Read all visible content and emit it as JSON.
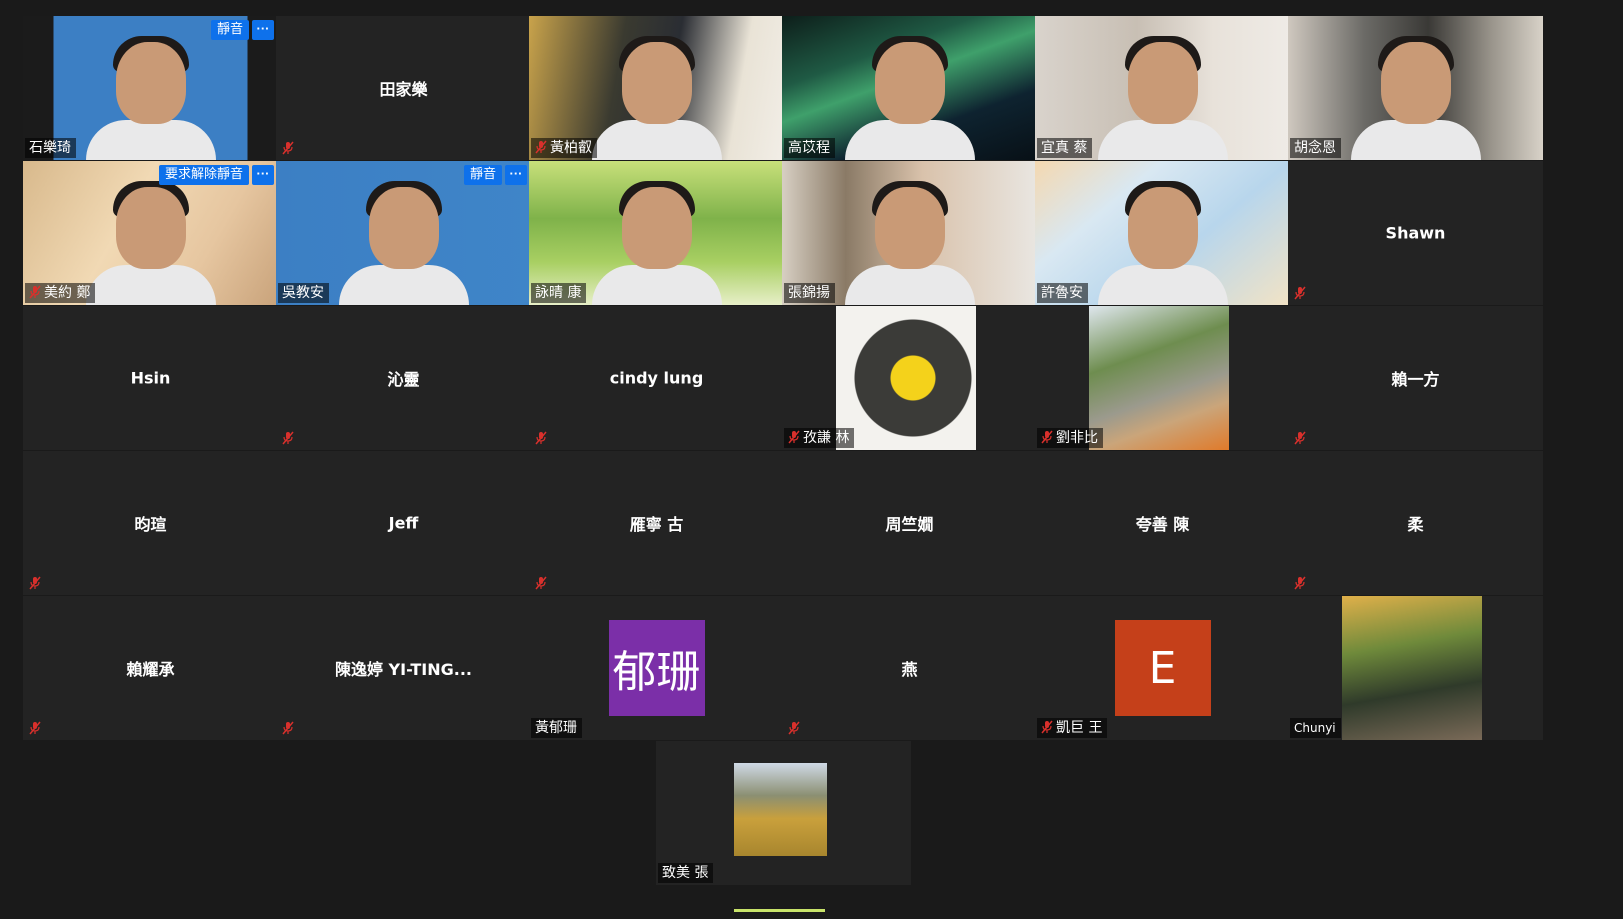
{
  "participants": [
    {
      "name": "石樂琦",
      "mode": "video",
      "speaking": true,
      "badge": "靜音",
      "more": "···",
      "muted": false
    },
    {
      "name": "田家樂",
      "mode": "name",
      "muted": true
    },
    {
      "name": "黃柏叡",
      "mode": "video",
      "muted": true
    },
    {
      "name": "高苡程",
      "mode": "video",
      "muted": false
    },
    {
      "name": "宜真 蔡",
      "mode": "video",
      "muted": false
    },
    {
      "name": "胡念恩",
      "mode": "video",
      "muted": false
    },
    {
      "name": "美約 鄭",
      "mode": "video",
      "badge": "要求解除靜音",
      "more": "···",
      "muted": true
    },
    {
      "name": "吳教安",
      "mode": "video",
      "badge": "靜音",
      "more": "···",
      "muted": false
    },
    {
      "name": "詠晴 康",
      "mode": "video",
      "muted": false
    },
    {
      "name": "張錦揚",
      "mode": "video",
      "muted": false
    },
    {
      "name": "許魯安",
      "mode": "video",
      "muted": false
    },
    {
      "name": "Shawn",
      "mode": "name",
      "muted": true
    },
    {
      "name": "Hsin",
      "mode": "name",
      "muted": false
    },
    {
      "name": "沁靈",
      "mode": "name",
      "muted": true
    },
    {
      "name": "cindy lung",
      "mode": "name",
      "muted": true
    },
    {
      "name": "孜謙 林",
      "mode": "picture",
      "muted": true
    },
    {
      "name": "劉非比",
      "mode": "picture",
      "muted": true
    },
    {
      "name": "賴一方",
      "mode": "name",
      "muted": true
    },
    {
      "name": "昀瑄",
      "mode": "name",
      "muted": true
    },
    {
      "name": "Jeff",
      "mode": "name",
      "muted": false
    },
    {
      "name": "雁寧 古",
      "mode": "name",
      "muted": true
    },
    {
      "name": "周竺嫺",
      "mode": "name",
      "muted": false
    },
    {
      "name": "夸善 陳",
      "mode": "name",
      "muted": false
    },
    {
      "name": "柔",
      "mode": "name",
      "muted": true
    },
    {
      "name": "賴耀承",
      "mode": "name",
      "muted": true
    },
    {
      "name": "陳逸婷 YI-TING...",
      "mode": "name",
      "muted": true
    },
    {
      "name": "黃郁珊",
      "mode": "avatar",
      "avatar_text": "郁珊",
      "avatar_color": "#7b2fa8",
      "muted": false
    },
    {
      "name": "燕",
      "mode": "name",
      "muted": true
    },
    {
      "name": "凱巨 王",
      "mode": "avatar",
      "avatar_text": "E",
      "avatar_color": "#c5401a",
      "muted": true
    },
    {
      "name": "Chunyi",
      "mode": "picture",
      "muted": false
    },
    {
      "name": "致美 張",
      "mode": "picture",
      "muted": false
    }
  ],
  "colors": {
    "background": "#1a1a1a",
    "tile": "#232323",
    "speaking_outline": "#c8e36a",
    "badge": "#0e71eb",
    "mute_red": "#d9302c"
  }
}
